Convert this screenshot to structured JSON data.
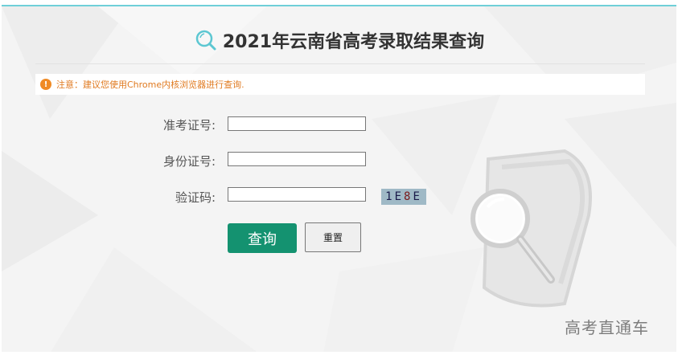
{
  "header": {
    "title": "2021年云南省高考录取结果查询",
    "title_icon": "search-icon"
  },
  "notice": {
    "icon": "exclamation-icon",
    "text": "注意：建议您使用Chrome内核浏览器进行查询."
  },
  "form": {
    "exam_number_label": "准考证号:",
    "exam_number_value": "",
    "id_number_label": "身份证号:",
    "id_number_value": "",
    "captcha_label": "验证码:",
    "captcha_value": "",
    "captcha_image": [
      "1",
      "E",
      "8",
      "E"
    ]
  },
  "buttons": {
    "query_label": "查询",
    "reset_label": "重置"
  },
  "watermark": "高考直通车",
  "colors": {
    "accent_border": "#6fcfd8",
    "query_button": "#149270",
    "notice_text": "#e07a20"
  }
}
